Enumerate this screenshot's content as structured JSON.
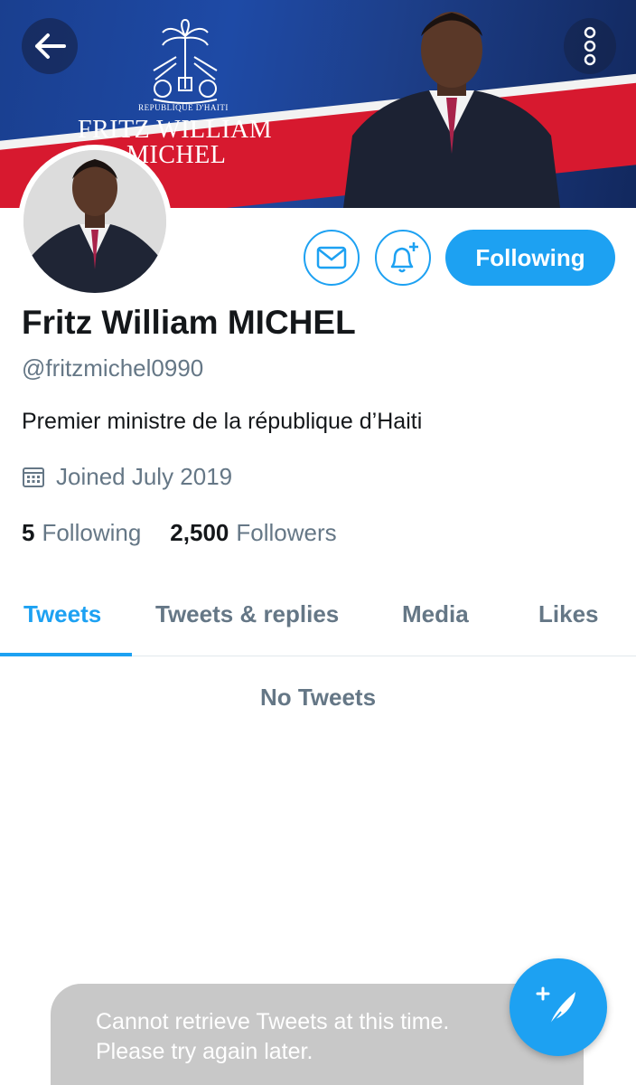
{
  "banner": {
    "title_line1": "FRITZ WILLIAM",
    "title_line2": "MICHEL",
    "seal_caption": "REPUBLIQUE D'HAITI"
  },
  "nav": {
    "back_icon": "arrow-left-icon",
    "more_icon": "more-vertical-icon"
  },
  "actions": {
    "message_icon": "envelope-icon",
    "notify_icon": "bell-plus-icon",
    "following_label": "Following"
  },
  "profile": {
    "display_name": "Fritz William MICHEL",
    "handle": "@fritzmichel0990",
    "bio": "Premier ministre de la république d’Haiti",
    "joined": "Joined July 2019",
    "following_count": "5",
    "following_label": "Following",
    "followers_count": "2,500",
    "followers_label": "Followers"
  },
  "tabs": [
    {
      "label": "Tweets",
      "active": true
    },
    {
      "label": "Tweets & replies",
      "active": false
    },
    {
      "label": "Media",
      "active": false
    },
    {
      "label": "Likes",
      "active": false
    }
  ],
  "timeline": {
    "empty_text": "No Tweets"
  },
  "toast": {
    "line1": "Cannot retrieve Tweets at this time.",
    "line2": "Please try again later."
  },
  "fab": {
    "icon": "compose-tweet-icon"
  },
  "colors": {
    "accent": "#1da1f2",
    "secondary_text": "#657786",
    "primary_text": "#14171a"
  }
}
